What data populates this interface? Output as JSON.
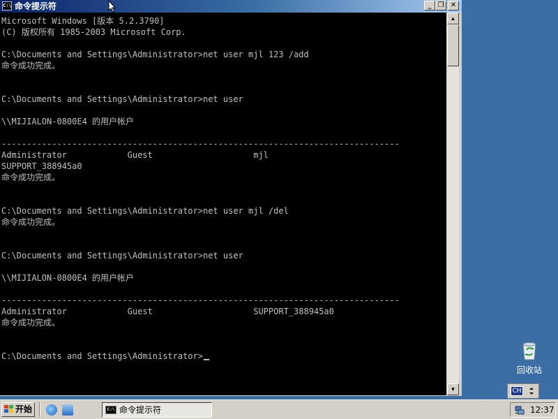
{
  "window": {
    "title": "命令提示符",
    "icon_text": "C:\\",
    "buttons": {
      "minimize": "_",
      "restore": "❐",
      "close": "✕"
    }
  },
  "console": {
    "lines": [
      "Microsoft Windows [版本 5.2.3790]",
      "(C) 版权所有 1985-2003 Microsoft Corp.",
      "",
      "C:\\Documents and Settings\\Administrator>net user mjl 123 /add",
      "命令成功完成。",
      "",
      "",
      "C:\\Documents and Settings\\Administrator>net user",
      "",
      "\\\\MIJIALON-0800E4 的用户帐户",
      "",
      "-------------------------------------------------------------------------------",
      "Administrator            Guest                    mjl",
      "SUPPORT_388945a0",
      "命令成功完成。",
      "",
      "",
      "C:\\Documents and Settings\\Administrator>net user mjl /del",
      "命令成功完成。",
      "",
      "",
      "C:\\Documents and Settings\\Administrator>net user",
      "",
      "\\\\MIJIALON-0800E4 的用户帐户",
      "",
      "-------------------------------------------------------------------------------",
      "Administrator            Guest                    SUPPORT_388945a0",
      "命令成功完成。",
      "",
      "",
      "C:\\Documents and Settings\\Administrator>"
    ]
  },
  "scrollbar": {
    "up_arrow": "▲",
    "down_arrow": "▼"
  },
  "desktop": {
    "recycle_bin_label": "回收站",
    "language_indicator": "CH"
  },
  "taskbar": {
    "start_label": "开始",
    "task_label": "命令提示符",
    "clock": "12:37"
  },
  "colors": {
    "desktop": "#3a6ea5",
    "titlebar_start": "#0a246a",
    "titlebar_end": "#a6caf0",
    "console_bg": "#000000",
    "console_fg": "#c0c0c0"
  }
}
